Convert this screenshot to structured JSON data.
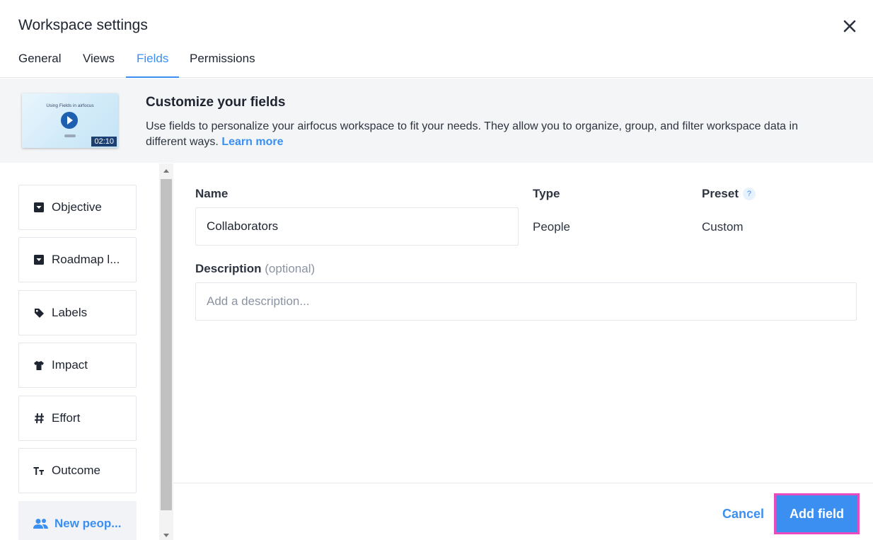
{
  "header": {
    "title": "Workspace settings"
  },
  "tabs": [
    {
      "label": "General"
    },
    {
      "label": "Views"
    },
    {
      "label": "Fields"
    },
    {
      "label": "Permissions"
    }
  ],
  "active_tab": "Fields",
  "banner": {
    "video_caption": "Using Fields in airfocus",
    "video_duration": "02:10",
    "title": "Customize your fields",
    "description": "Use fields to personalize your airfocus workspace to fit your needs. They allow you to organize, group, and filter workspace data in different ways.",
    "link_label": "Learn more"
  },
  "fields": [
    {
      "label": "Objective",
      "icon": "dropdown-square-icon"
    },
    {
      "label": "Roadmap l...",
      "icon": "dropdown-square-icon"
    },
    {
      "label": "Labels",
      "icon": "tag-icon"
    },
    {
      "label": "Impact",
      "icon": "shirt-icon"
    },
    {
      "label": "Effort",
      "icon": "hash-icon"
    },
    {
      "label": "Outcome",
      "icon": "text-icon"
    },
    {
      "label": "New peop...",
      "icon": "people-icon"
    }
  ],
  "form": {
    "name_label": "Name",
    "name_value": "Collaborators",
    "type_label": "Type",
    "type_value": "People",
    "preset_label": "Preset",
    "preset_help": "?",
    "preset_value": "Custom",
    "description_label": "Description",
    "description_optional": "(optional)",
    "description_placeholder": "Add a description..."
  },
  "footer": {
    "cancel_label": "Cancel",
    "add_label": "Add field"
  },
  "colors": {
    "accent": "#3b8ff0",
    "highlight_border": "#e84bc0"
  }
}
